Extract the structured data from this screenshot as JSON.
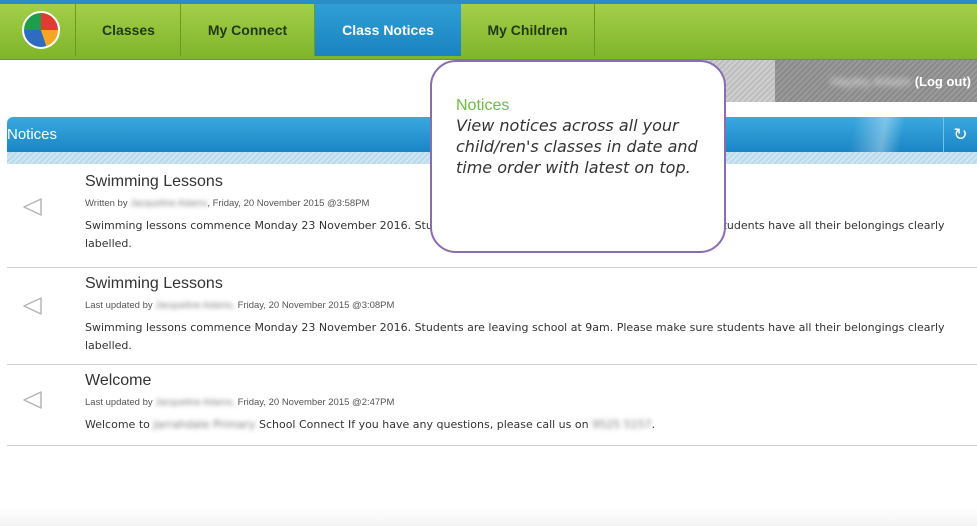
{
  "nav": {
    "tabs": [
      {
        "label": "Classes"
      },
      {
        "label": "My Connect"
      },
      {
        "label": "Class Notices"
      },
      {
        "label": "My Children"
      }
    ]
  },
  "user": {
    "name": "Hayley Arkam",
    "logout": "(Log out)"
  },
  "panel": {
    "title": "Notices"
  },
  "notices": [
    {
      "title": "Swimming Lessons",
      "meta_prefix": "Written by",
      "author": "Jacqueline Adams",
      "date": ", Friday, 20 November 2015 @3:58PM",
      "text": "Swimming lessons commence Monday 23 November 2016. Students are leaving school at 9am. Please make sure students have all their belongings clearly labelled."
    },
    {
      "title": "Swimming Lessons",
      "meta_prefix": "Last updated by",
      "author": "Jacqueline Adams,",
      "date": " Friday, 20 November 2015 @3:08PM",
      "text": "Swimming lessons commence Monday 23 November 2016. Students are leaving school at 9am. Please make sure students have all their belongings clearly labelled."
    },
    {
      "title": "Welcome",
      "meta_prefix": "Last updated by",
      "author": "Jacqueline Adams,",
      "date": " Friday, 20 November 2015 @2:47PM",
      "text_prefix": "Welcome to ",
      "school": "Jarrahdale Primary",
      "text_middle": " School Connect If you have any questions, please call us on ",
      "phone": "9525 5157",
      "text_suffix": "."
    }
  ],
  "callout": {
    "title": "Notices",
    "text": "View notices across all your child/ren's classes in date and time order with latest on top."
  }
}
